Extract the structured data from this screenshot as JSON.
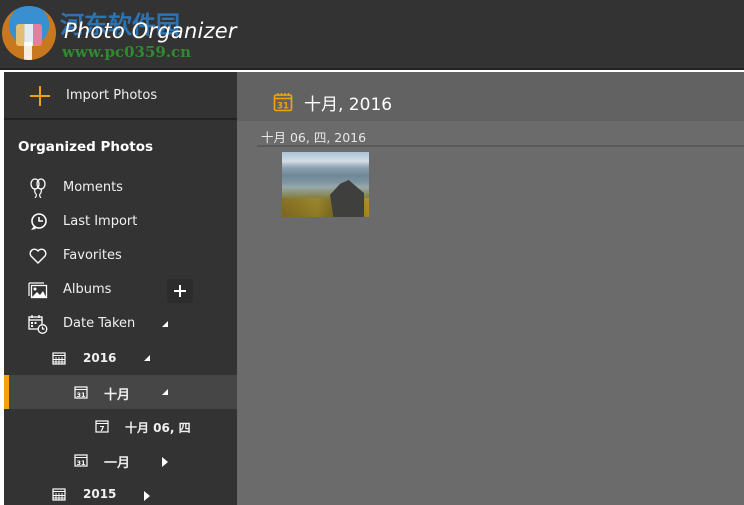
{
  "app": {
    "title": "Photo Organizer",
    "watermark_text": "河东软件园",
    "watermark_url": "www.pc0359.cn"
  },
  "sidebar": {
    "import_label": "Import Photos",
    "section_title": "Organized Photos",
    "items": [
      {
        "label": "Moments",
        "icon": "balloons-icon"
      },
      {
        "label": "Last Import",
        "icon": "clock-arrow-icon"
      },
      {
        "label": "Favorites",
        "icon": "heart-icon"
      },
      {
        "label": "Albums",
        "icon": "image-icon"
      },
      {
        "label": "Date Taken",
        "icon": "calendar-clock-icon",
        "expanded": true
      }
    ],
    "date_tree": [
      {
        "label": "2016",
        "level": 1,
        "icon": "calendar-grid-icon",
        "expanded": true
      },
      {
        "label": "十月",
        "level": 2,
        "icon": "calendar-31-icon",
        "expanded": true,
        "selected": true
      },
      {
        "label": "十月 06, 四",
        "level": 3,
        "icon": "calendar-day-icon"
      },
      {
        "label": "一月",
        "level": 2,
        "icon": "calendar-31-icon",
        "expanded": false
      },
      {
        "label": "2015",
        "level": 1,
        "icon": "calendar-grid-icon",
        "expanded": false
      }
    ]
  },
  "main": {
    "title": "十月, 2016",
    "groups": [
      {
        "date_label": "十月 06, 四, 2016",
        "photos": [
          {
            "description": "mountain landscape with autumn foliage"
          }
        ]
      }
    ]
  },
  "colors": {
    "accent": "#f0a30a",
    "sidebar_bg": "#333333",
    "content_bg": "#6b6b6b",
    "header_bg": "#636262"
  }
}
